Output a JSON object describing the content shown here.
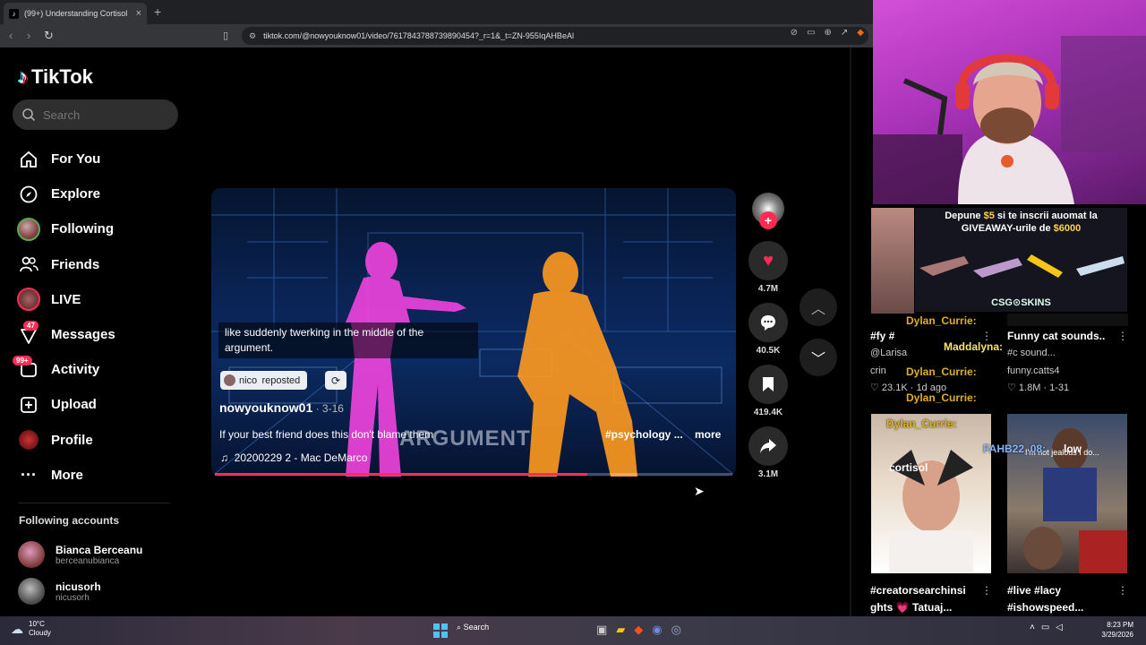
{
  "browser": {
    "tab_title": "(99+) Understanding Cortisol",
    "tab_close": "×",
    "new_tab": "+",
    "url": "tiktok.com/@nowyouknow01/video/7617843788739890454?_r=1&_t=ZN-955IqAHBeAl"
  },
  "sidebar": {
    "logo": "TikTok",
    "search_placeholder": "Search",
    "nav": [
      {
        "label": "For You",
        "icon": "home-icon"
      },
      {
        "label": "Explore",
        "icon": "compass-icon"
      },
      {
        "label": "Following",
        "icon": "following-avatar"
      },
      {
        "label": "Friends",
        "icon": "friends-icon"
      },
      {
        "label": "LIVE",
        "icon": "live-avatar"
      },
      {
        "label": "Messages",
        "icon": "messages-icon",
        "badge": "47"
      },
      {
        "label": "Activity",
        "icon": "activity-icon",
        "badge": "99+"
      },
      {
        "label": "Upload",
        "icon": "upload-icon"
      },
      {
        "label": "Profile",
        "icon": "profile-avatar"
      },
      {
        "label": "More",
        "icon": "more-icon"
      }
    ],
    "following_header": "Following accounts",
    "accounts": [
      {
        "name": "Bianca Berceanu",
        "handle": "berceanubianca"
      },
      {
        "name": "nicusorh",
        "handle": "nicusorh"
      }
    ]
  },
  "video": {
    "caption": "like suddenly twerking in the middle of the argument.",
    "repost_label": "nico  reposted",
    "author": "nowyouknow01",
    "date": " · 3-16",
    "description": "If your best friend does this don't blame them",
    "overlay_word": "ARGUMENT",
    "hashtag": "#psychology ...",
    "more": "more",
    "music": "20200229 2 - Mac DeMarco",
    "progress": 0.72
  },
  "actions": {
    "likes": "4.7M",
    "comments": "40.5K",
    "saves": "419.4K",
    "shares": "3.1M"
  },
  "overlay": {
    "promo_line1": "Depune ",
    "promo_amount1": "$5",
    "promo_line1b": " si te inscrii auomat la",
    "promo_line2": "GIVEAWAY-urile de ",
    "promo_amount2": "$6000",
    "promo_brand": "CSG⊙SKINS",
    "feed": {
      "card1_title": "#fy #",
      "card1_sub": "@Larisa",
      "card1_sub2": "crin",
      "card1_meta": "♡ 23.1K · 1d ago",
      "card2_title": "Funny cat sounds..",
      "card2_sub": "#c  sound...",
      "card2_sub2": "funny.catts4",
      "card2_meta": "♡ 1.8M · 1-31",
      "card3_title": "#creatorsearchinsi",
      "card3_title2": "ghts 💗 Tatuaj...",
      "card3_overlay": "cortisol",
      "card4_title": "#live #lacy",
      "card4_title2": "#ishowspeed...",
      "card4_overlay": "I'm not jealous I do..."
    },
    "chat": {
      "user1": "Dylan_Currie:",
      "user2": "Maddalyna:",
      "user3": "Dylan_Currie:",
      "user4": "Dylan_Currie:",
      "user5": "Dylan_Currie:",
      "user6": "FAHB22_08:",
      "user6_msg": "low"
    }
  },
  "taskbar": {
    "temp": "10°C",
    "weather": "Cloudy",
    "search": "Search",
    "time": "8:23 PM",
    "date": "3/29/2026"
  },
  "colors": {
    "accent": "#fe2c55",
    "cyan": "#25f4ee"
  }
}
